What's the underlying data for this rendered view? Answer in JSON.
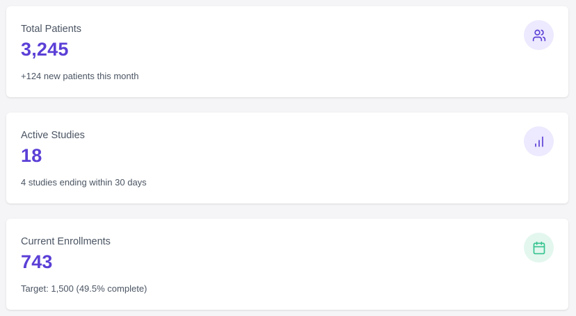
{
  "cards": [
    {
      "label": "Total Patients",
      "value": "3,245",
      "subtext": "+124 new patients this month",
      "icon": "users-icon",
      "icon_color": "#5b3fd6",
      "icon_bg": "#ede9fe"
    },
    {
      "label": "Active Studies",
      "value": "18",
      "subtext": "4 studies ending within 30 days",
      "icon": "bar-chart-icon",
      "icon_color": "#5b3fd6",
      "icon_bg": "#ede9fe"
    },
    {
      "label": "Current Enrollments",
      "value": "743",
      "subtext": "Target: 1,500 (49.5% complete)",
      "icon": "calendar-icon",
      "icon_color": "#34c38f",
      "icon_bg": "#e3f7ee"
    }
  ],
  "colors": {
    "accent": "#5b3fd6",
    "success": "#34c38f",
    "text_muted": "#4b5563",
    "background": "#f5f5f7"
  }
}
